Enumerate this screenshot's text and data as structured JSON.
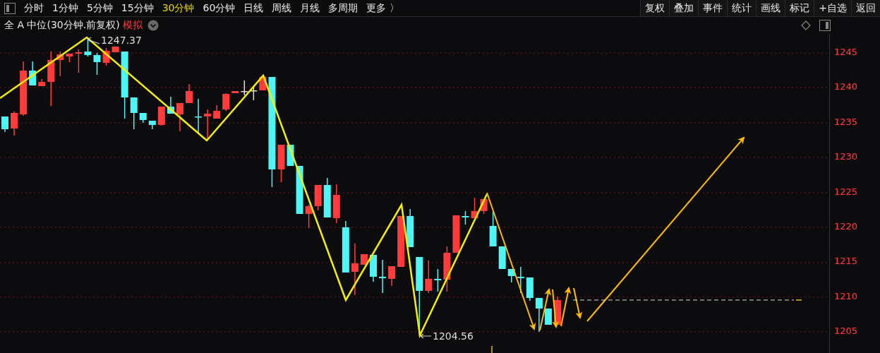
{
  "toolbar": {
    "periods": [
      {
        "label": "分时",
        "selected": false
      },
      {
        "label": "1分钟",
        "selected": false
      },
      {
        "label": "5分钟",
        "selected": false
      },
      {
        "label": "15分钟",
        "selected": false
      },
      {
        "label": "30分钟",
        "selected": true
      },
      {
        "label": "60分钟",
        "selected": false
      },
      {
        "label": "日线",
        "selected": false
      },
      {
        "label": "周线",
        "selected": false
      },
      {
        "label": "月线",
        "selected": false
      },
      {
        "label": "多周期",
        "selected": false
      }
    ],
    "more": "更多 〉",
    "actions": [
      "复权",
      "叠加",
      "事件",
      "统计",
      "画线",
      "标记",
      "+自选",
      "返回"
    ]
  },
  "chart": {
    "title": "全 A 中位(30分钟.前复权)",
    "mode": "模拟",
    "high_label": "1247.37",
    "low_label": "1204.56",
    "price_ticks": [
      "1245",
      "1240",
      "1235",
      "1230",
      "1225",
      "1220",
      "1215",
      "1210",
      "1205"
    ]
  }
}
